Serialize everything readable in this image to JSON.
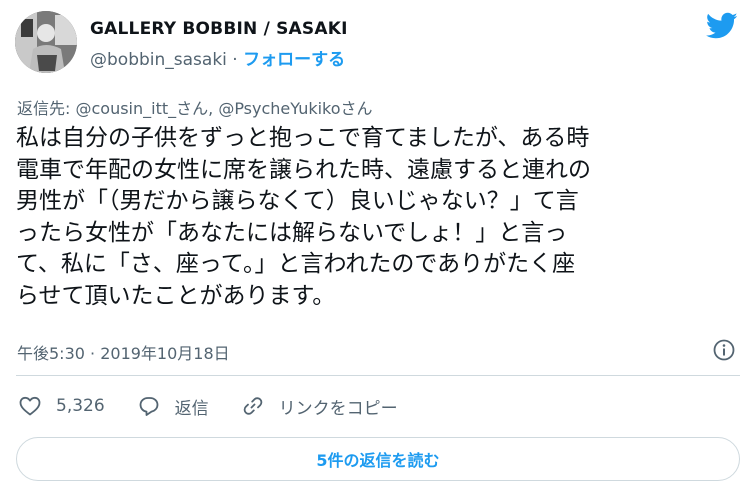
{
  "author": {
    "display_name": "GALLERY BOBBIN / SASAKI",
    "handle": "@bobbin_sasaki",
    "separator": "·",
    "follow_label": "フォローする",
    "avatar_icon": "user-avatar"
  },
  "logo_icon": "twitter-bird-icon",
  "reply_to": {
    "prefix": "返信先: ",
    "mention1": "@cousin_itt_さん",
    "joiner": ", ",
    "mention2": "@PsycheYukikoさん"
  },
  "tweet_lines": [
    "私は自分の子供をずっと抱っこで育てましたが、ある時",
    "電車で年配の女性に席を譲られた時、遠慮すると連れの",
    "男性が「（男だから譲らなくて）良いじゃない？」て言",
    "ったら女性が「あなたには解らないでしょ！」と言っ",
    "て、私に「さ、座って。」と言われたのでありがたく座",
    "らせて頂いたことがあります。"
  ],
  "meta": {
    "time": "午後5:30",
    "separator": " · ",
    "date": "2019年10月18日"
  },
  "actions": {
    "like_count": "5,326",
    "reply_label": "返信",
    "copy_link_label": "リンクをコピー"
  },
  "read_replies_label": "5件の返信を読む",
  "colors": {
    "accent": "#1d9bf0",
    "text": "#0f1419",
    "secondary": "#536471",
    "border": "#cfd9de"
  }
}
